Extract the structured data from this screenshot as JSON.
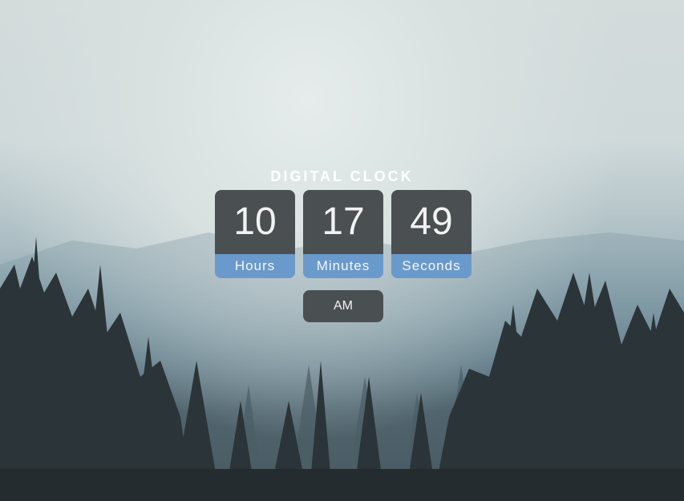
{
  "title": "DIGITAL CLOCK",
  "clock": {
    "hours": "10",
    "minutes": "17",
    "seconds": "49",
    "hours_label": "Hours",
    "minutes_label": "Minutes",
    "seconds_label": "Seconds",
    "period": "AM"
  },
  "colors": {
    "tile": "#4a4f51",
    "label_band": "#6a9acb",
    "title_text": "#ffffff"
  }
}
